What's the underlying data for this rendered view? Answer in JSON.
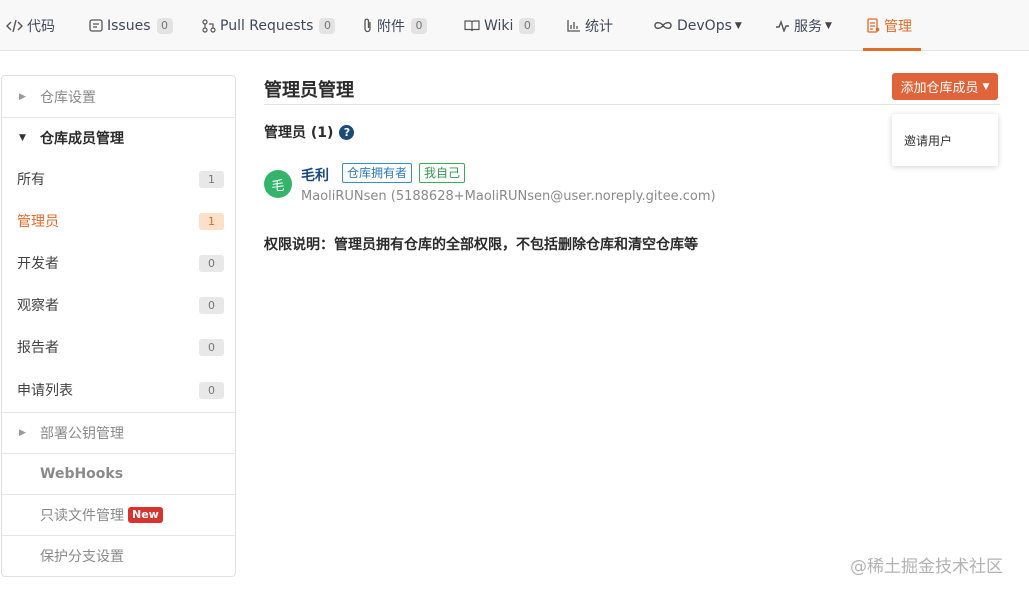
{
  "nav": {
    "code": "代码",
    "issues": {
      "label": "Issues",
      "count": "0"
    },
    "pull_requests": {
      "label": "Pull Requests",
      "count": "0"
    },
    "attachments": {
      "label": "附件",
      "count": "0"
    },
    "wiki": {
      "label": "Wiki",
      "count": "0"
    },
    "stats": "统计",
    "devops": "DevOps",
    "services": "服务",
    "manage": "管理"
  },
  "sidebar": {
    "repo_settings": "仓库设置",
    "member_management": "仓库成员管理",
    "roles": [
      {
        "label": "所有",
        "count": "1"
      },
      {
        "label": "管理员",
        "count": "1"
      },
      {
        "label": "开发者",
        "count": "0"
      },
      {
        "label": "观察者",
        "count": "0"
      },
      {
        "label": "报告者",
        "count": "0"
      },
      {
        "label": "申请列表",
        "count": "0"
      }
    ],
    "deploy_keys": "部署公钥管理",
    "webhooks": "WebHooks",
    "readonly_files": "只读文件管理",
    "new_badge": "New",
    "branch_protection": "保护分支设置"
  },
  "main": {
    "title": "管理员管理",
    "add_member_button": "添加仓库成员",
    "dropdown_invite": "邀请用户",
    "section_heading": "管理员 (1)",
    "help_glyph": "?",
    "member": {
      "avatar_char": "毛",
      "name": "毛利",
      "tag_owner": "仓库拥有者",
      "tag_self": "我自己",
      "detail": "MaoliRUNsen (5188628+MaoliRUNsen@user.noreply.gitee.com)"
    },
    "permission_note": "权限说明：管理员拥有仓库的全部权限，不包括删除仓库和清空仓库等"
  },
  "watermark": "@稀土掘金技术社区",
  "colors": {
    "accent": "#e06c27",
    "button": "#e0633a",
    "avatar": "#34b36b",
    "link": "#1b4b7a"
  }
}
